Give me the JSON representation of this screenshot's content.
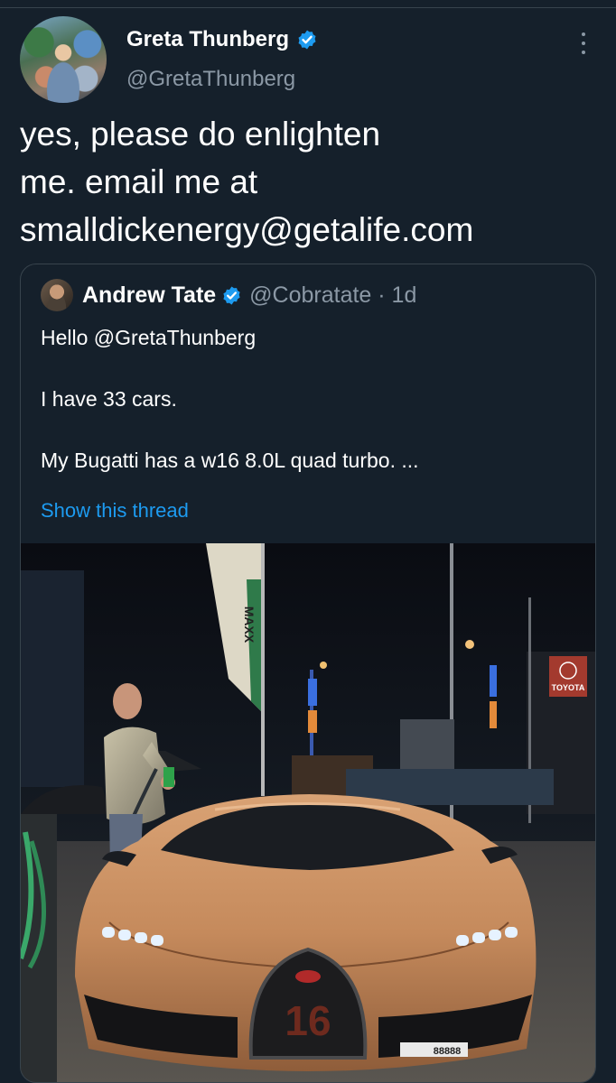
{
  "tweet": {
    "author_name": "Greta Thunberg",
    "author_handle": "@GretaThunberg",
    "verified": true,
    "text_lines": [
      "yes, please do enlighten",
      "me. email me at",
      "smalldickenergy@getalife.com"
    ]
  },
  "quoted": {
    "author_name": "Andrew Tate",
    "author_handle": "@Cobratate · 1d",
    "verified": true,
    "lines": [
      "Hello @GretaThunberg",
      "I have 33 cars.",
      "My Bugatti has a w16 8.0L quad turbo. ..."
    ],
    "show_thread": "Show this thread",
    "image": {
      "banner_text": "MAXX",
      "sign_text": "TOYOTA",
      "badge_text": "16",
      "plate_text": "88888"
    }
  },
  "colors": {
    "background": "#15202b",
    "accent": "#1d9bf0",
    "secondary_text": "#8b98a5",
    "border": "#38444d",
    "car": "#c58a5c"
  }
}
